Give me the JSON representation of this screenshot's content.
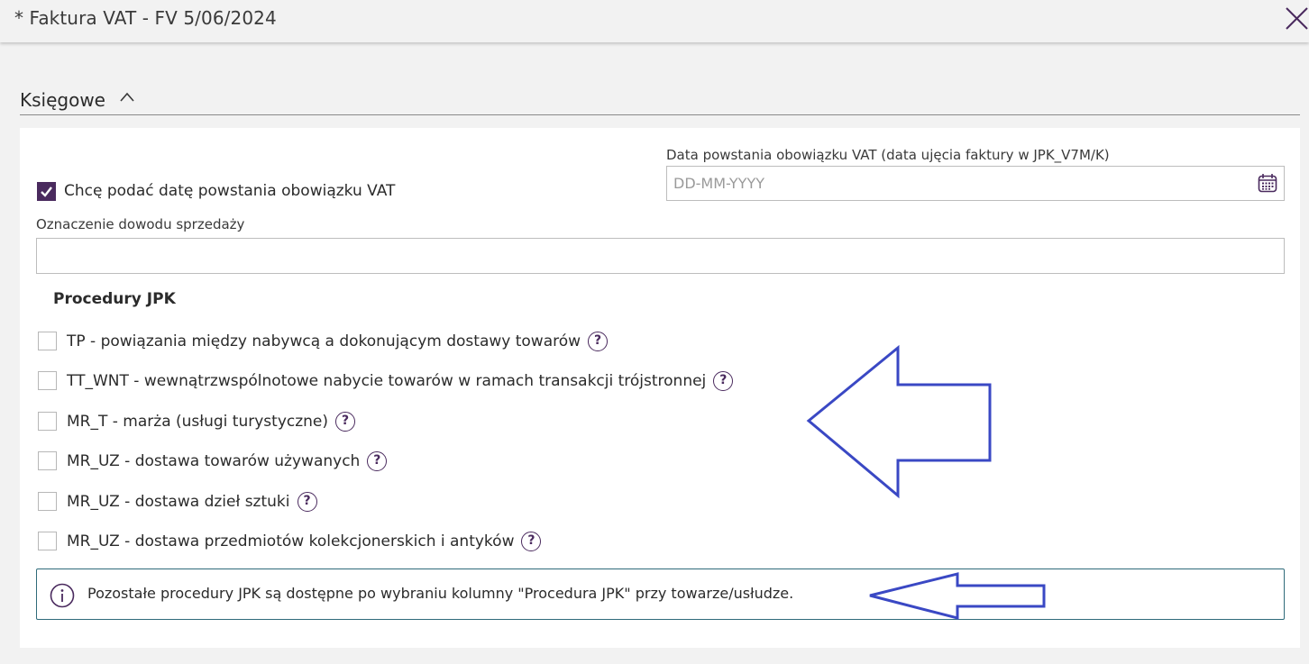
{
  "window": {
    "title": "* Faktura VAT - FV 5/06/2024",
    "close_icon": "close-icon"
  },
  "section": {
    "title": "Księgowe",
    "chevron_icon": "chevron-up-icon"
  },
  "vat_date": {
    "checkbox_label": "Chcę podać datę powstania obowiązku VAT",
    "checked": true,
    "field_label": "Data powstania obowiązku VAT (data ujęcia faktury w JPK_V7M/K)",
    "placeholder": "DD-MM-YYYY",
    "value": ""
  },
  "sale_proof": {
    "label": "Oznaczenie dowodu sprzedaży",
    "value": ""
  },
  "jpk": {
    "heading": "Procedury JPK",
    "procedures": [
      {
        "label": "TP - powiązania między nabywcą a dokonującym dostawy towarów",
        "checked": false
      },
      {
        "label": "TT_WNT - wewnątrzwspólnotowe nabycie towarów w ramach transakcji trójstronnej",
        "checked": false
      },
      {
        "label": "MR_T - marża (usługi turystyczne)",
        "checked": false
      },
      {
        "label": "MR_UZ - dostawa towarów używanych",
        "checked": false
      },
      {
        "label": "MR_UZ - dostawa dzieł sztuki",
        "checked": false
      },
      {
        "label": "MR_UZ - dostawa przedmiotów kolekcjonerskich i antyków",
        "checked": false
      }
    ],
    "help_glyph": "?"
  },
  "info": {
    "text": "Pozostałe procedury JPK są dostępne po wybraniu kolumny \"Procedura JPK\" przy towarze/usłudze.",
    "icon": "info-icon"
  },
  "colors": {
    "accent": "#4a2a5e",
    "annotation_arrow": "#3a48c4",
    "info_border": "#2f6b7a"
  }
}
